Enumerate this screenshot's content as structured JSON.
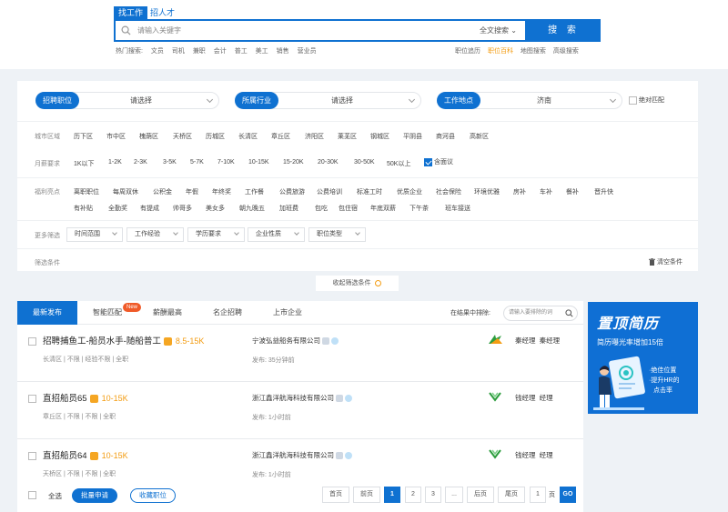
{
  "header": {
    "tab_find": "找工作",
    "tab_hire": "招人才",
    "search_placeholder": "请输入关键字",
    "search_type": "全文搜索",
    "search_button": "搜 索",
    "hot_label": "热门搜索:",
    "hot_terms": [
      "文员",
      "司机",
      "兼职",
      "会计",
      "普工",
      "美工",
      "销售",
      "营业员"
    ],
    "links": [
      "职位追历",
      "职位百科",
      "地图搜索",
      "高级搜索"
    ]
  },
  "filters": {
    "category_label": "招聘职位",
    "category_value": "请选择",
    "industry_label": "所属行业",
    "industry_value": "请选择",
    "location_label": "工作地点",
    "location_value": "济南",
    "exact_match": "绝对匹配",
    "district_label": "城市区域",
    "districts": [
      "历下区",
      "市中区",
      "槐荫区",
      "天桥区",
      "历城区",
      "长清区",
      "章丘区",
      "济阳区",
      "莱芜区",
      "钢城区",
      "平阴县",
      "商河县",
      "高新区"
    ],
    "salary_label": "月薪要求",
    "salaries": [
      "1K以下",
      "1-2K",
      "2-3K",
      "3-5K",
      "5-7K",
      "7-10K",
      "10-15K",
      "15-20K",
      "20-30K",
      "30-50K",
      "50K以上"
    ],
    "negotiable": "含面议",
    "benefits_label": "福利亮点",
    "benefits_row1": [
      "离职职位",
      "每周双休",
      "公积金",
      "年假",
      "年终奖",
      "工作餐",
      "公费旅游",
      "公费培训",
      "标准工时",
      "优质企业",
      "社会保险",
      "环境优雅",
      "房补",
      "车补",
      "餐补",
      "晋升快"
    ],
    "benefits_row2": [
      "有补贴",
      "全勤奖",
      "有提成",
      "帅哥多",
      "美女多",
      "朝九晚五",
      "加班费",
      "包吃",
      "包住宿",
      "年底双薪",
      "下午茶",
      "班车接送"
    ],
    "more_label": "更多筛选",
    "dropdowns": [
      "时间范围",
      "工作经验",
      "学历要求",
      "企业性质",
      "职位类型"
    ],
    "conditions_label": "筛选条件",
    "clear": "清空条件",
    "collapse": "收起筛选条件"
  },
  "results": {
    "tabs": [
      "最新发布",
      "智能匹配",
      "薪酬最高",
      "名企招聘",
      "上市企业"
    ],
    "new_badge": "New",
    "exclude_label": "在结果中排除:",
    "exclude_placeholder": "请输入要排除的词",
    "jobs": [
      {
        "title": "招聘捕鱼工-船员水手-随船普工",
        "salary": "8.5-15K",
        "meta": "长清区 | 不限 | 经验不限 | 全职",
        "company": "宁波弘益船务有限公司",
        "time": "发布: 35分钟前",
        "hr": "秦经理",
        "hr_role": "秦经理"
      },
      {
        "title": "直招船员65",
        "salary": "10-15K",
        "meta": "章丘区 | 不限 | 不限 | 全职",
        "company": "浙江鑫洋航海科技有限公司",
        "time": "发布: 1小时前",
        "hr": "钱经理",
        "hr_role": "经理"
      },
      {
        "title": "直招船员64",
        "salary": "10-15K",
        "meta": "天桥区 | 不限 | 不限 | 全职",
        "company": "浙江鑫洋航海科技有限公司",
        "time": "发布: 1小时前",
        "hr": "钱经理",
        "hr_role": "经理"
      }
    ],
    "select_all": "全选",
    "batch_apply": "批量申请",
    "favorite": "收藏职位",
    "pagination": [
      "首页",
      "前页",
      "1",
      "2",
      "3",
      "...",
      "后页",
      "尾页"
    ],
    "page_input": "1",
    "page_unit": "页",
    "go": "GO"
  },
  "ad": {
    "title": "置顶简历",
    "subtitle": "简历曝光率增加15倍",
    "bullet1": "·绝佳位置",
    "bullet2": "·提升HR的",
    "bullet3": "点击率"
  }
}
